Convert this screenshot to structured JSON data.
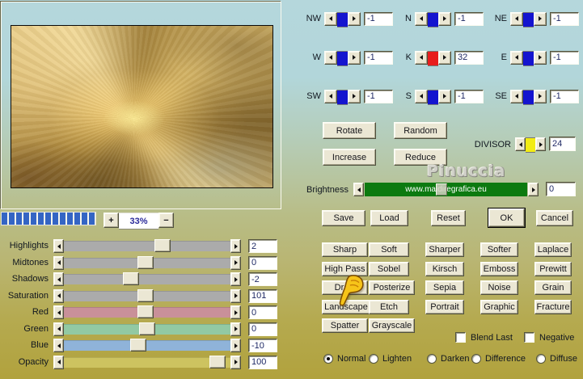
{
  "preview": {
    "zoom_value": "33%",
    "zoom_in": "+",
    "zoom_out": "−"
  },
  "kernel": {
    "cells": [
      {
        "label": "NW",
        "value": "-1",
        "color": "#1414cf"
      },
      {
        "label": "N",
        "value": "-1",
        "color": "#1414cf"
      },
      {
        "label": "NE",
        "value": "-1",
        "color": "#1414cf"
      },
      {
        "label": "W",
        "value": "-1",
        "color": "#1414cf"
      },
      {
        "label": "K",
        "value": "32",
        "color": "#e81c1c"
      },
      {
        "label": "E",
        "value": "-1",
        "color": "#1414cf"
      },
      {
        "label": "SW",
        "value": "-1",
        "color": "#1414cf"
      },
      {
        "label": "S",
        "value": "-1",
        "color": "#1414cf"
      },
      {
        "label": "SE",
        "value": "-1",
        "color": "#1414cf"
      }
    ]
  },
  "divisor": {
    "label": "DIVISOR",
    "value": "24",
    "color": "#f2ec14"
  },
  "action_buttons": {
    "rotate": "Rotate",
    "random": "Random",
    "increase": "Increase",
    "reduce": "Reduce"
  },
  "brand": {
    "name": "Pinuccia",
    "watermark": "www.maidiregrafica.eu"
  },
  "brightness": {
    "label": "Brightness",
    "value": "0"
  },
  "main_buttons": [
    {
      "label": "Save",
      "default": false
    },
    {
      "label": "Load",
      "default": false
    },
    {
      "label": "Reset",
      "default": false
    },
    {
      "label": "OK",
      "default": true
    },
    {
      "label": "Cancel",
      "default": false
    }
  ],
  "filter_buttons": [
    "Sharp",
    "Soft",
    "Sharper",
    "Softer",
    "Laplace",
    "High Pass",
    "Sobel",
    "Kirsch",
    "Emboss",
    "Prewitt",
    "Draw",
    "Posterize",
    "Sepia",
    "Noise",
    "Grain",
    "Landscape",
    "Etch",
    "Portrait",
    "Graphic",
    "Fracture",
    "Spatter",
    "Grayscale"
  ],
  "checkboxes": [
    {
      "label": "Blend Last",
      "checked": false
    },
    {
      "label": "Negative",
      "checked": false
    }
  ],
  "blend_modes": [
    {
      "label": "Normal",
      "selected": true
    },
    {
      "label": "Lighten",
      "selected": false
    },
    {
      "label": "Darken",
      "selected": false
    },
    {
      "label": "Difference",
      "selected": false
    },
    {
      "label": "Diffuse",
      "selected": false
    }
  ],
  "sliders": [
    {
      "label": "Highlights",
      "value": "2",
      "pos": 0.6,
      "track_color": "#ababab"
    },
    {
      "label": "Midtones",
      "value": "0",
      "pos": 0.49,
      "track_color": "#ababab"
    },
    {
      "label": "Shadows",
      "value": "-2",
      "pos": 0.39,
      "track_color": "#ababab"
    },
    {
      "label": "Saturation",
      "value": "101",
      "pos": 0.49,
      "track_color": "#ababab"
    },
    {
      "label": "Red",
      "value": "0",
      "pos": 0.49,
      "track_color": "#c99099"
    },
    {
      "label": "Green",
      "value": "0",
      "pos": 0.5,
      "track_color": "#92c9a3"
    },
    {
      "label": "Blue",
      "value": "-10",
      "pos": 0.44,
      "track_color": "#8fb3d9"
    },
    {
      "label": "Opacity",
      "value": "100",
      "pos": 0.97,
      "track_color": "#cdc360"
    }
  ]
}
